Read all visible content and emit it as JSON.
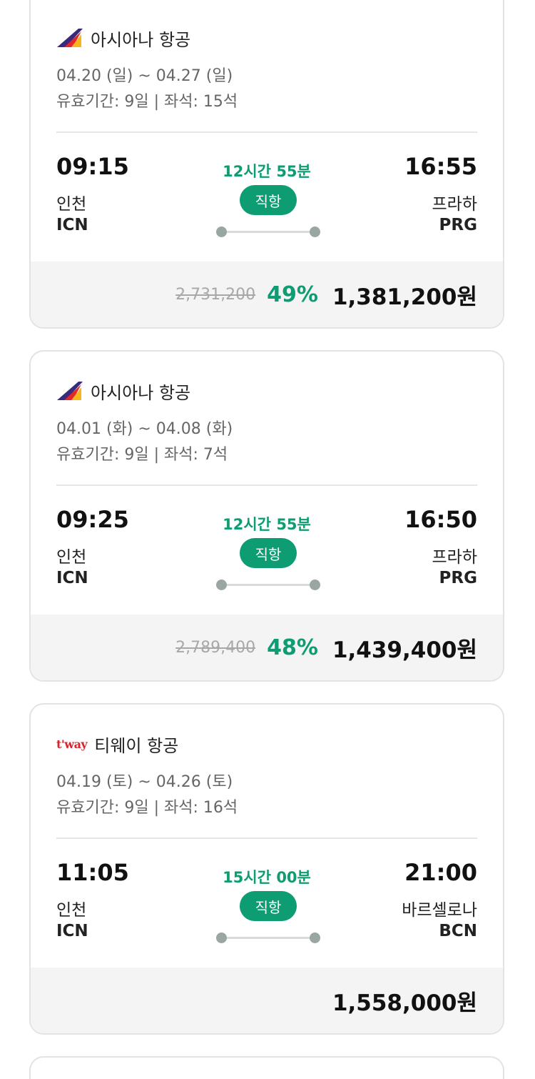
{
  "flights": [
    {
      "airline": "아시아나 항공",
      "logo_icon": "asiana-logo-icon",
      "dates": "04.20 (일) ~ 04.27 (일)",
      "meta": "유효기간: 9일 | 좌석: 15석",
      "departure": {
        "time": "09:15",
        "city": "인천",
        "code": "ICN"
      },
      "arrival": {
        "time": "16:55",
        "city": "프라하",
        "code": "PRG"
      },
      "duration": "12시간 55분",
      "direct_label": "직항",
      "original_price": "2,731,200",
      "discount": "49%",
      "price": "1,381,200원"
    },
    {
      "airline": "아시아나 항공",
      "logo_icon": "asiana-logo-icon",
      "dates": "04.01 (화) ~ 04.08 (화)",
      "meta": "유효기간: 9일 | 좌석: 7석",
      "departure": {
        "time": "09:25",
        "city": "인천",
        "code": "ICN"
      },
      "arrival": {
        "time": "16:50",
        "city": "프라하",
        "code": "PRG"
      },
      "duration": "12시간 55분",
      "direct_label": "직항",
      "original_price": "2,789,400",
      "discount": "48%",
      "price": "1,439,400원"
    },
    {
      "airline": "티웨이 항공",
      "logo_text": "t'way",
      "logo_icon": "tway-logo-icon",
      "dates": "04.19 (토) ~ 04.26 (토)",
      "meta": "유효기간: 9일 | 좌석: 16석",
      "departure": {
        "time": "11:05",
        "city": "인천",
        "code": "ICN"
      },
      "arrival": {
        "time": "21:00",
        "city": "바르셀로나",
        "code": "BCN"
      },
      "duration": "15시간 00분",
      "direct_label": "직항",
      "price": "1,558,000원"
    }
  ],
  "colors": {
    "accent": "#0e9c72",
    "card_border": "#e3e3e3",
    "price_bar_bg": "#f4f4f4",
    "asiana_red": "#e2262b",
    "asiana_yellow": "#f6b51a",
    "asiana_purple": "#3b2a7c",
    "tway_red": "#d7242d"
  }
}
